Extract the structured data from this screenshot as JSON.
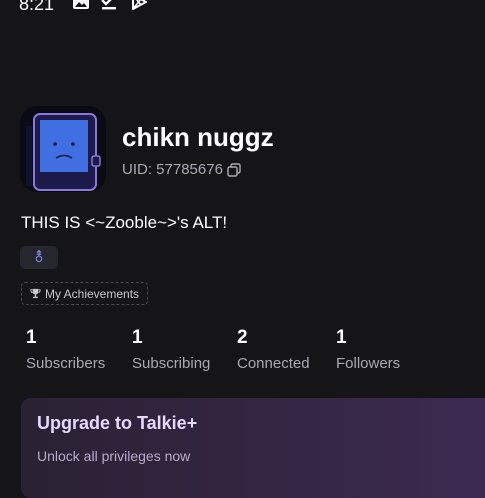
{
  "status_bar": {
    "time": "8:21",
    "icons": [
      "image-icon",
      "check-done-icon",
      "play-store-icon"
    ]
  },
  "profile": {
    "name": "chikn nuggz",
    "uid": "UID: 57785676",
    "bio": "THIS IS <~Zooble~>'s ALT!",
    "gender_symbol": "⚨",
    "achievements_label": "My Achievements"
  },
  "stats": [
    {
      "count": "1",
      "label": "Subscribers"
    },
    {
      "count": "1",
      "label": "Subscribing"
    },
    {
      "count": "2",
      "label": "Connected"
    },
    {
      "count": "1",
      "label": "Followers"
    }
  ],
  "upgrade": {
    "title": "Upgrade to Talkie+",
    "subtitle": "Unlock all privileges now"
  },
  "colors": {
    "background": "#151416",
    "accent": "#7f8fe8",
    "upgrade_gradient_end": "#3e2a52"
  }
}
